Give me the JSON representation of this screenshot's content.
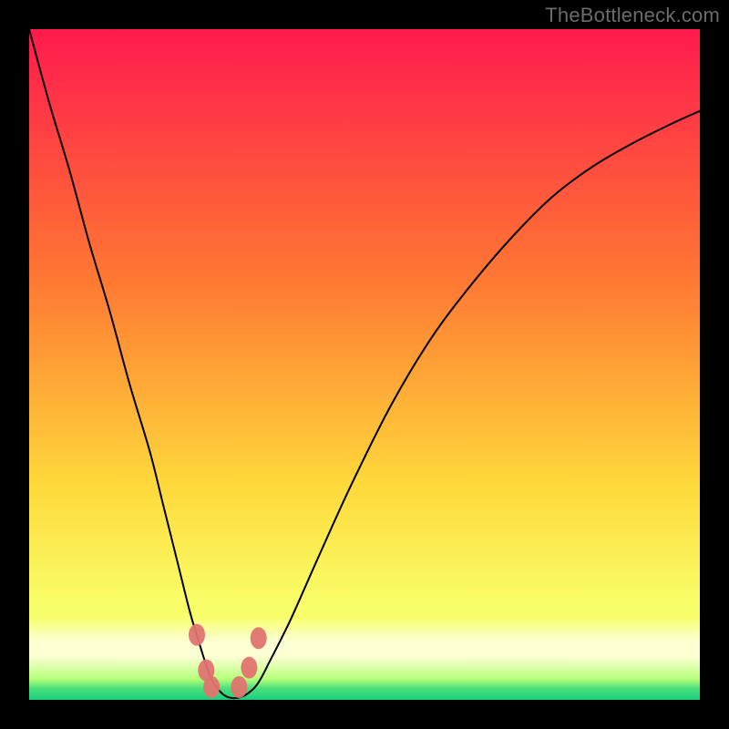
{
  "watermark": {
    "text": "TheBottleneck.com"
  },
  "colors": {
    "frame_bg": "#000000",
    "grad_top": "#ff1a4d",
    "grad_mid1": "#ff7a33",
    "grad_mid2": "#ffd93b",
    "grad_low": "#f8ff6a",
    "pale_band": "#fbffd2",
    "green_top": "#b6ff7a",
    "green_mid": "#4de07a",
    "green_bot": "#18d07f",
    "curve": "#000000",
    "marker": "#e07470"
  },
  "chart_data": {
    "type": "line",
    "title": "",
    "xlabel": "",
    "ylabel": "",
    "xlim": [
      0,
      100
    ],
    "ylim": [
      0,
      100
    ],
    "notes": "Axes are unlabeled in the image; x and y treated as 0–100 percent of plot width/height. y=0 is bottom edge.",
    "series": [
      {
        "name": "bottleneck-curve",
        "x": [
          0,
          3,
          6,
          9,
          12,
          15,
          18,
          20,
          22,
          24,
          25.5,
          27,
          28.5,
          30,
          32,
          34,
          36,
          39,
          43,
          48,
          54,
          60,
          66,
          72,
          78,
          84,
          90,
          96,
          100
        ],
        "y": [
          100,
          89,
          79,
          68,
          58,
          47,
          37,
          29,
          21,
          13,
          8,
          3.5,
          1.2,
          0.3,
          0.6,
          2.3,
          6,
          12,
          21,
          32,
          44,
          54,
          62,
          69,
          75,
          79.5,
          83,
          86,
          87.8
        ]
      }
    ],
    "markers": {
      "name": "highlight-dots",
      "points": [
        {
          "x": 25.0,
          "y": 9.7
        },
        {
          "x": 26.4,
          "y": 4.4
        },
        {
          "x": 27.2,
          "y": 1.9
        },
        {
          "x": 31.3,
          "y": 1.9
        },
        {
          "x": 32.8,
          "y": 4.8
        },
        {
          "x": 34.2,
          "y": 9.2
        }
      ]
    },
    "bands": {
      "green_stripe_height_pct": 3.1,
      "green_fade_height_pct": 3.3,
      "pale_band_height_pct": 6.0,
      "pale_band_bottom_pct": 6.4
    }
  }
}
